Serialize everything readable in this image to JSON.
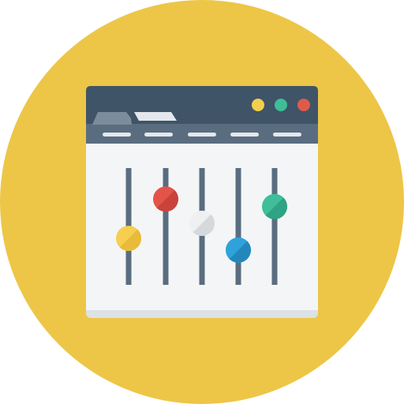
{
  "icon": {
    "name": "browser-equalizer-icon",
    "colors": {
      "circle_background": "#EDC647",
      "titlebar": "#3F5467",
      "tabbar": "#5A6D80",
      "tab_active": "#7D8C9C",
      "tab_inactive": "#E4E8EC",
      "content": "#F4F5F6",
      "content_bottom": "#DDE2E6",
      "slider_track": "#5A6D80",
      "window_dot_yellow": "#F4CF4E",
      "window_dot_green": "#3DBE96",
      "window_dot_red": "#E05A4B"
    },
    "window_controls": [
      "minimize-dot",
      "maximize-dot",
      "close-dot"
    ],
    "sliders": [
      {
        "name": "slider-1",
        "knob_color": "#F6CE50",
        "knob_shade": "#E8BB3A",
        "level": 0.32
      },
      {
        "name": "slider-2",
        "knob_color": "#E4534A",
        "knob_shade": "#C9433B",
        "level": 0.79
      },
      {
        "name": "slider-3",
        "knob_color": "#EEF0F1",
        "knob_shade": "#D5D9DC",
        "level": 0.5
      },
      {
        "name": "slider-4",
        "knob_color": "#2EA3DB",
        "knob_shade": "#2288BB",
        "level": 0.18
      },
      {
        "name": "slider-5",
        "knob_color": "#3EBE99",
        "knob_shade": "#2FA383",
        "level": 0.7
      }
    ]
  }
}
